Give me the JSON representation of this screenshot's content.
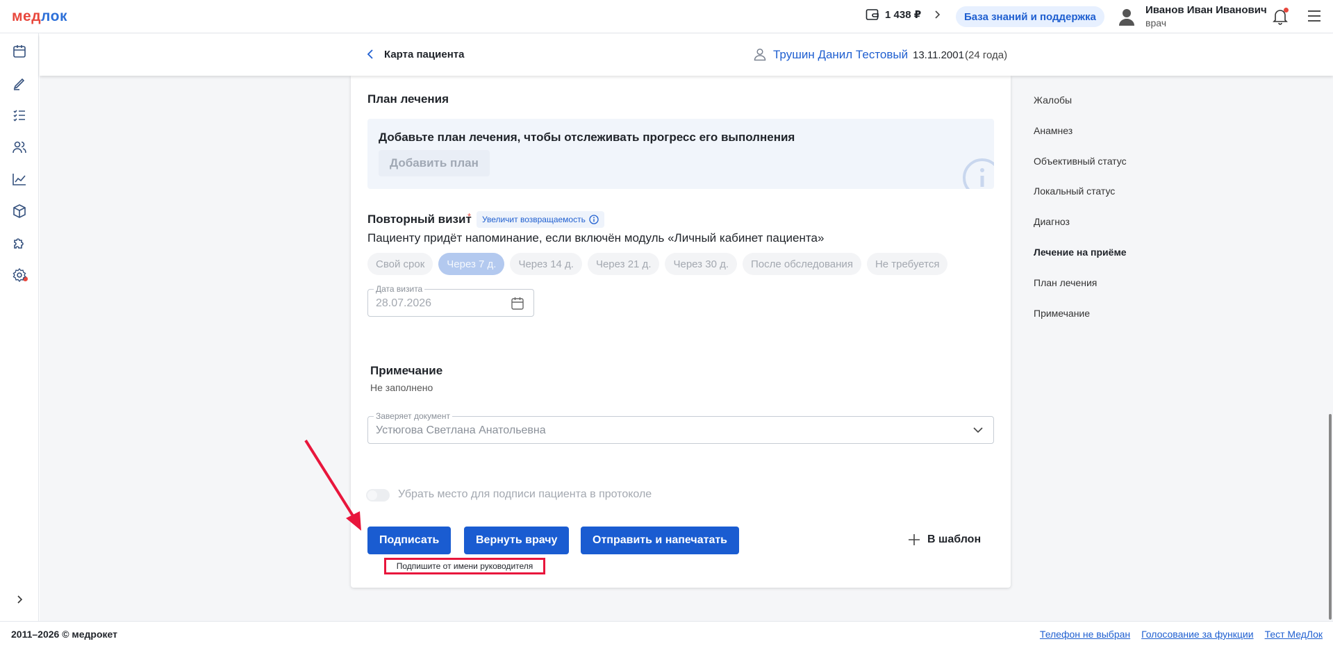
{
  "header": {
    "logo_part1": "мед",
    "logo_part2": "лок",
    "balance": "1 438 ₽",
    "knowledge_base": "База знаний и поддержка",
    "user_name": "Иванов Иван Иванович",
    "user_role": "врач"
  },
  "subheader": {
    "title": "Карта пациента",
    "patient_name": "Трушин Данил Тестовый",
    "patient_dob": "13.11.2001",
    "patient_age": "(24 года)"
  },
  "sidebar": {
    "icons": [
      "calendar-icon",
      "pen-icon",
      "checklist-icon",
      "users-icon",
      "chart-icon",
      "box-icon",
      "puzzle-icon",
      "settings-icon",
      "expand-icon"
    ]
  },
  "plan": {
    "title": "План лечения",
    "prompt": "Добавьте план лечения, чтобы отслеживать прогресс его выполнения",
    "add_button": "Добавить план"
  },
  "revisit": {
    "title": "Повторный визит",
    "required_mark": "*",
    "badge": "Увеличит возвращаемость",
    "note": "Пациенту придёт напоминание, если включён модуль «Личный кабинет пациента»",
    "chips": [
      "Свой срок",
      "Через 7 д.",
      "Через 14 д.",
      "Через 21 д.",
      "Через 30 д.",
      "После обследования",
      "Не требуется"
    ],
    "active_chip": "Через 7 д.",
    "date_label": "Дата визита",
    "date_value": "28.07.2026"
  },
  "note": {
    "title": "Примечание",
    "value": "Не заполнено"
  },
  "certifier": {
    "label": "Заверяет документ",
    "value": "Устюгова Светлана Анатольевна"
  },
  "signature_toggle": {
    "label": "Убрать место для подписи пациента в протоколе",
    "checked": false
  },
  "actions": {
    "sign": "Подписать",
    "return": "Вернуть врачу",
    "send_print": "Отправить и напечатать",
    "template": "В шаблон",
    "hint": "Подпишите от имени руководителя"
  },
  "anchor_nav": {
    "items": [
      "Жалобы",
      "Анамнез",
      "Объективный статус",
      "Локальный статус",
      "Диагноз",
      "Лечение на приёме",
      "План лечения",
      "Примечание"
    ],
    "active": "Лечение на приёме"
  },
  "footer": {
    "copyright": "2011–2026 © медрокет",
    "links": [
      "Телефон не выбран",
      "Голосование за функции",
      "Тест МедЛок"
    ]
  },
  "colors": {
    "primary": "#1a5cd1",
    "brand_red": "#e8473c",
    "highlight_red": "#e8163c"
  }
}
